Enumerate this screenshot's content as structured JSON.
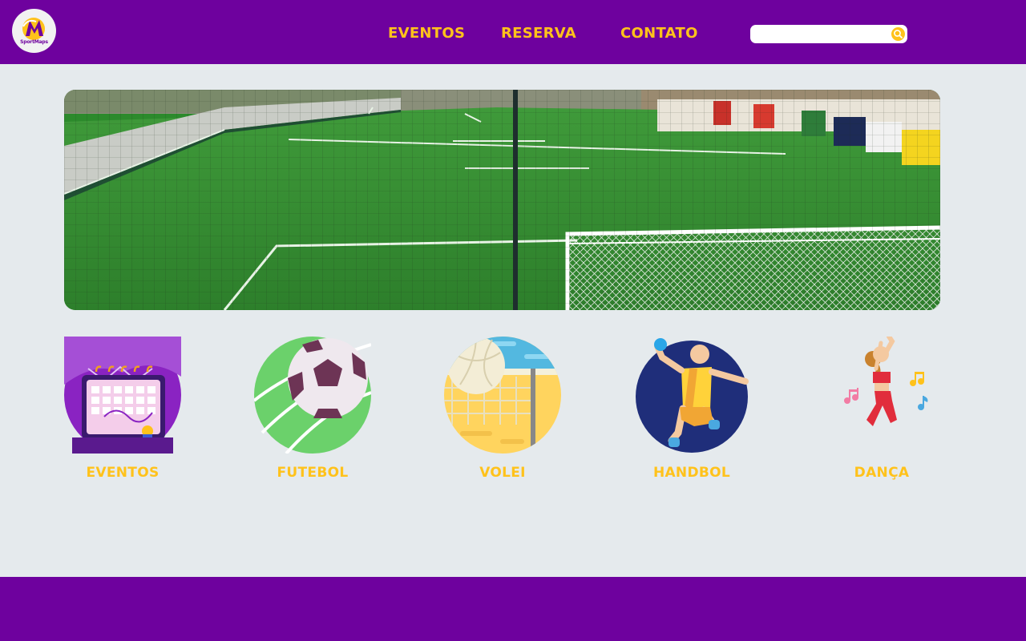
{
  "header": {
    "logo_text": "SportMaps",
    "nav": [
      {
        "label": "EVENTOS"
      },
      {
        "label": "RESERVA"
      },
      {
        "label": "CONTATO"
      }
    ],
    "search": {
      "value": "",
      "placeholder": ""
    }
  },
  "hero": {
    "image_alt": ""
  },
  "categories": [
    {
      "label": "EVENTOS",
      "icon": "calendar-event-icon"
    },
    {
      "label": "FUTEBOL",
      "icon": "soccer-ball-icon"
    },
    {
      "label": "VOLEI",
      "icon": "volleyball-icon"
    },
    {
      "label": "HANDBOL",
      "icon": "handball-player-icon"
    },
    {
      "label": "DANÇA",
      "icon": "dancer-icon"
    }
  ],
  "colors": {
    "brand_purple": "#6e019e",
    "accent_yellow": "#ffc21b",
    "background": "#e5eaed"
  }
}
